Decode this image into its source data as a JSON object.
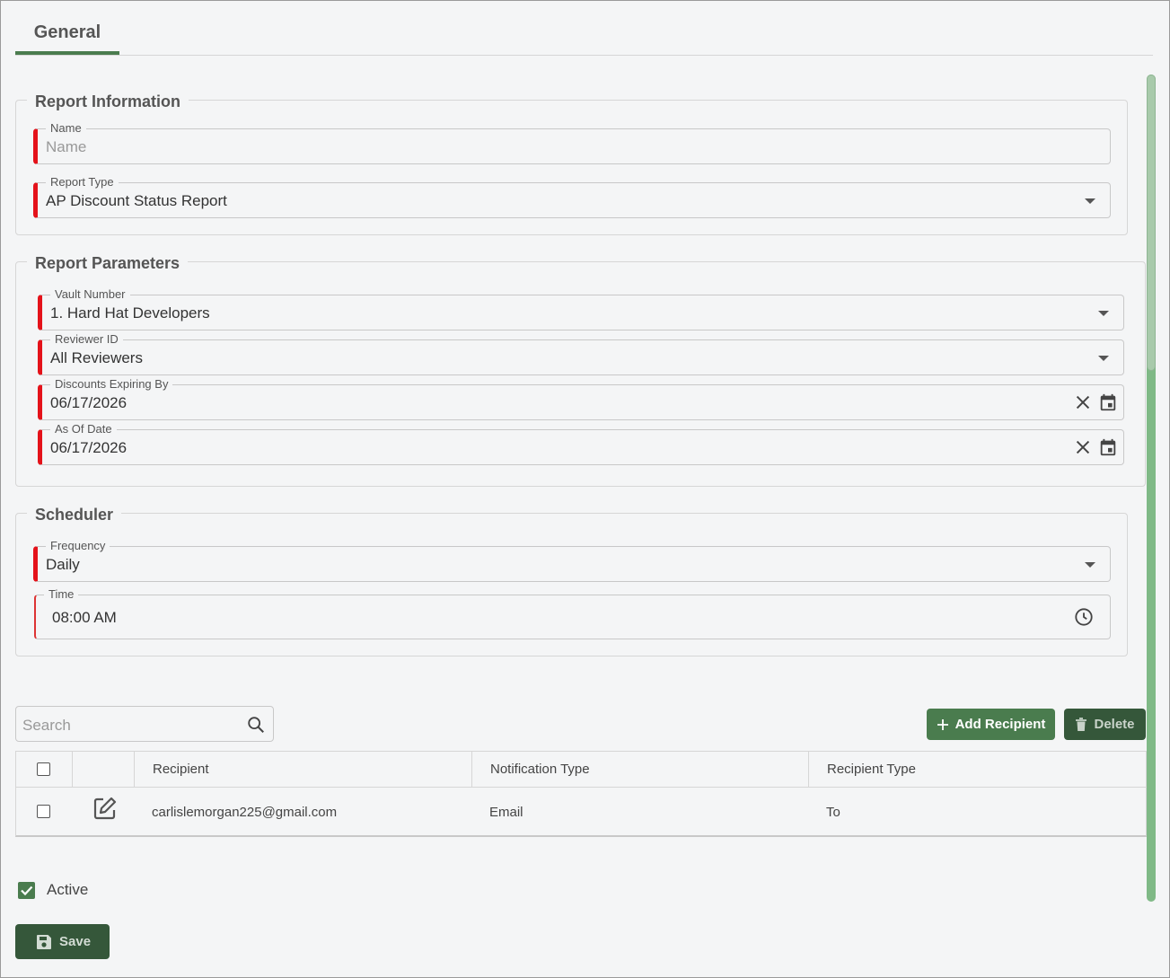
{
  "tabs": [
    {
      "label": "General"
    }
  ],
  "report_information": {
    "title": "Report Information",
    "name": {
      "label": "Name",
      "placeholder": "Name",
      "value": ""
    },
    "report_type": {
      "label": "Report Type",
      "value": "AP Discount Status Report"
    }
  },
  "report_parameters": {
    "title": "Report Parameters",
    "vault_number": {
      "label": "Vault Number",
      "value": "1. Hard Hat Developers"
    },
    "reviewer_id": {
      "label": "Reviewer ID",
      "value": "All Reviewers"
    },
    "discounts_expiring_by": {
      "label": "Discounts Expiring By",
      "value": "06/17/2026"
    },
    "as_of_date": {
      "label": "As Of Date",
      "value": "06/17/2026"
    }
  },
  "scheduler": {
    "title": "Scheduler",
    "frequency": {
      "label": "Frequency",
      "value": "Daily"
    },
    "time": {
      "label": "Time",
      "value": "08:00 AM"
    }
  },
  "recipients": {
    "search_placeholder": "Search",
    "add_label": "Add Recipient",
    "delete_label": "Delete",
    "columns": [
      "Recipient",
      "Notification Type",
      "Recipient Type"
    ],
    "rows": [
      {
        "recipient": "carlislemorgan225@gmail.com",
        "notification_type": "Email",
        "recipient_type": "To"
      }
    ]
  },
  "active": {
    "label": "Active",
    "checked": true
  },
  "save_label": "Save",
  "colors": {
    "accent": "#4a7c4e",
    "accent_dark": "#35573a",
    "required": "#e4121a",
    "scrollbar": "#7fb986"
  },
  "icons": [
    "caret-down-icon",
    "clear-icon",
    "calendar-icon",
    "clock-icon",
    "search-icon",
    "plus-icon",
    "trash-icon",
    "edit-icon",
    "save-icon",
    "check-icon"
  ]
}
